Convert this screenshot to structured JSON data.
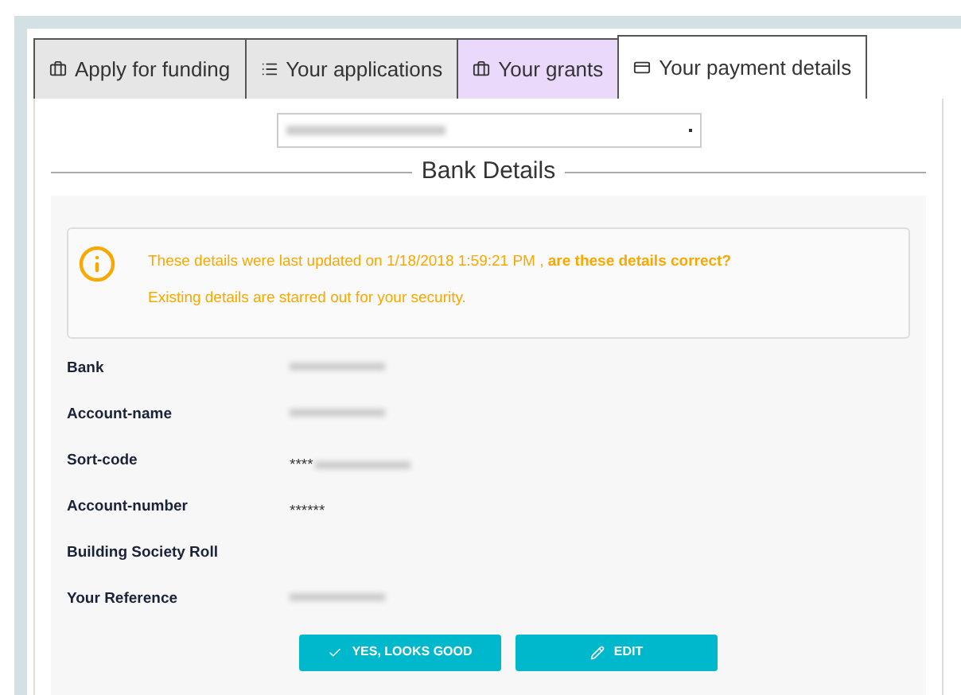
{
  "tabs": [
    {
      "label": "Apply for funding",
      "kind": "briefcase",
      "selected": false,
      "highlighted": false
    },
    {
      "label": "Your applications",
      "kind": "list",
      "selected": false,
      "highlighted": false
    },
    {
      "label": "Your grants",
      "kind": "briefcase",
      "selected": false,
      "highlighted": true
    },
    {
      "label": "Your payment details",
      "kind": "card",
      "selected": true,
      "highlighted": false
    }
  ],
  "section_title": "Bank Details",
  "alert": {
    "message": "These details were last updated on 1/18/2018 1:59:21 PM , **are these details correct?**",
    "note": "Existing details are starred out for your security."
  },
  "fields": [
    {
      "label": "Bank",
      "blurred": true
    },
    {
      "label": "Account-name",
      "blurred": true
    },
    {
      "label": "Sort-code",
      "value": "****",
      "blurred": true
    },
    {
      "label": "Account-number",
      "value": "******",
      "blurred": false
    },
    {
      "label": "Building Society Roll",
      "blurred": false
    },
    {
      "label": "Your Reference",
      "blurred": true
    }
  ],
  "buttons": [
    {
      "label": "YES, LOOKS GOOD",
      "kind": "confirm"
    },
    {
      "label": "EDIT",
      "kind": "edit"
    }
  ]
}
